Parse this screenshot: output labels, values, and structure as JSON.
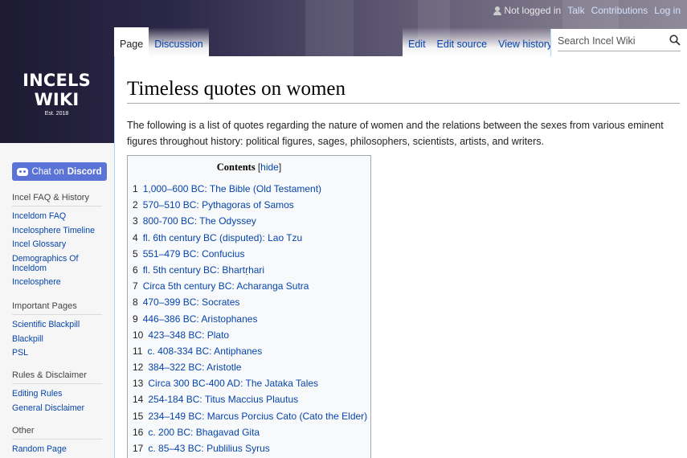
{
  "logo": {
    "name": "INCELS WIKI",
    "est": "Est. 2018"
  },
  "personal": {
    "not_logged_in": "Not logged in",
    "talk": "Talk",
    "contributions": "Contributions",
    "login": "Log in"
  },
  "tabs": {
    "left": [
      "Page",
      "Discussion"
    ],
    "right": [
      "Edit",
      "Edit source",
      "View history"
    ]
  },
  "search": {
    "placeholder": "Search Incel Wiki"
  },
  "sidebar": {
    "chat_prefix": "Chat on",
    "chat_brand": "Discord",
    "portals": [
      {
        "heading": "Incel FAQ & History",
        "items": [
          "Inceldom FAQ",
          "Incelosphere Timeline",
          "Incel Glossary",
          "Demographics Of Inceldom",
          "Incelosphere"
        ]
      },
      {
        "heading": "Important Pages",
        "items": [
          "Scientific Blackpill",
          "Blackpill",
          "PSL"
        ]
      },
      {
        "heading": "Rules & Disclaimer",
        "items": [
          "Editing Rules",
          "General Disclaimer"
        ]
      },
      {
        "heading": "Other",
        "items": [
          "Random Page"
        ]
      }
    ]
  },
  "page": {
    "title": "Timeless quotes on women",
    "intro": "The following is a list of quotes regarding the nature of women and the relations between the sexes from various eminent figures throughout history: political figures, sages, philosophers, scientists, artists, and writers."
  },
  "toc": {
    "title": "Contents",
    "hide_open": "[",
    "hide_label": "hide",
    "hide_close": "]",
    "items": [
      {
        "num": "1",
        "text": "1,000–600 BC: The Bible (Old Testament)"
      },
      {
        "num": "2",
        "text": "570–510 BC: Pythagoras of Samos"
      },
      {
        "num": "3",
        "text": "800-700 BC: The Odyssey"
      },
      {
        "num": "4",
        "text": "fl. 6th century BC (disputed): Lao Tzu"
      },
      {
        "num": "5",
        "text": "551–479 BC: Confucius"
      },
      {
        "num": "6",
        "text": "fl. 5th century BC: Bhartṛhari"
      },
      {
        "num": "7",
        "text": "Circa 5th century BC: Acharanga Sutra"
      },
      {
        "num": "8",
        "text": "470–399 BC: Socrates"
      },
      {
        "num": "9",
        "text": "446–386 BC: Aristophanes"
      },
      {
        "num": "10",
        "text": "423–348 BC: Plato"
      },
      {
        "num": "11",
        "text": "c. 408-334 BC: Antiphanes"
      },
      {
        "num": "12",
        "text": "384–322 BC: Aristotle"
      },
      {
        "num": "13",
        "text": "Circa 300 BC-400 AD: The Jataka Tales"
      },
      {
        "num": "14",
        "text": "254-184 BC: Titus Maccius Plautus"
      },
      {
        "num": "15",
        "text": "234–149 BC: Marcus Porcius Cato (Cato the Elder)"
      },
      {
        "num": "16",
        "text": "c. 200 BC: Bhagavad Gita"
      },
      {
        "num": "17",
        "text": "c. 85–43 BC: Publilius Syrus"
      }
    ]
  }
}
